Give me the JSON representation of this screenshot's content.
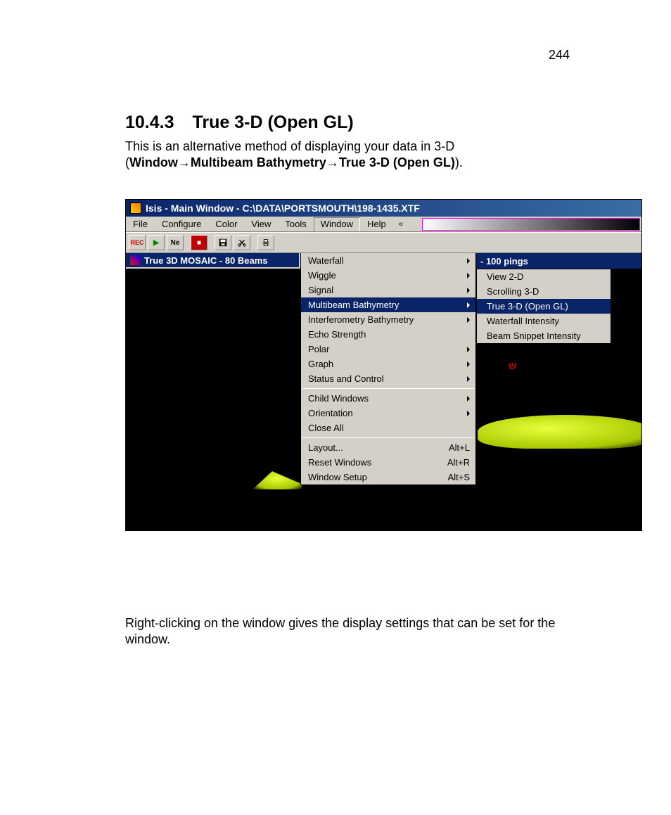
{
  "page_number": "244",
  "heading": {
    "number": "10.4.3",
    "title": "True 3-D (Open GL)"
  },
  "intro_pre": "This is an alternative method of displaying your data in 3-D (",
  "intro_bold": "Window→Multibeam Bathymetry→True 3-D (Open GL)",
  "intro_post": ").",
  "titlebar": "Isis - Main Window - C:\\DATA\\PORTSMOUTH\\198-1435.XTF",
  "menubar": [
    "File",
    "Configure",
    "Color",
    "View",
    "Tools",
    "Window",
    "Help"
  ],
  "menubar_chevron": "«",
  "left_pane_title": "True 3D MOSAIC  - 80 Beams",
  "right_pane_title": "- 100 pings",
  "window_menu": {
    "group1": [
      {
        "label": "Waterfall",
        "arrow": true
      },
      {
        "label": "Wiggle",
        "arrow": true
      },
      {
        "label": "Signal",
        "arrow": true
      },
      {
        "label": "Multibeam Bathymetry",
        "arrow": true,
        "active": true
      },
      {
        "label": "Interferometry Bathymetry",
        "arrow": true
      },
      {
        "label": "Echo Strength"
      },
      {
        "label": "Polar",
        "arrow": true
      },
      {
        "label": "Graph",
        "arrow": true
      },
      {
        "label": "Status and Control",
        "arrow": true
      }
    ],
    "group2": [
      {
        "label": "Child Windows",
        "arrow": true
      },
      {
        "label": "Orientation",
        "arrow": true
      },
      {
        "label": "Close All"
      }
    ],
    "group3": [
      {
        "label": "Layout...",
        "shortcut": "Alt+L"
      },
      {
        "label": "Reset Windows",
        "shortcut": "Alt+R"
      },
      {
        "label": "Window Setup",
        "shortcut": "Alt+S"
      }
    ]
  },
  "submenu": [
    {
      "label": "View 2-D"
    },
    {
      "label": "Scrolling 3-D"
    },
    {
      "label": "True 3-D (Open GL)",
      "active": true
    },
    {
      "label": "Waterfall Intensity"
    },
    {
      "label": "Beam Snippet Intensity"
    }
  ],
  "lower_text": "Right-clicking on the window gives the display settings that can be set for the window."
}
